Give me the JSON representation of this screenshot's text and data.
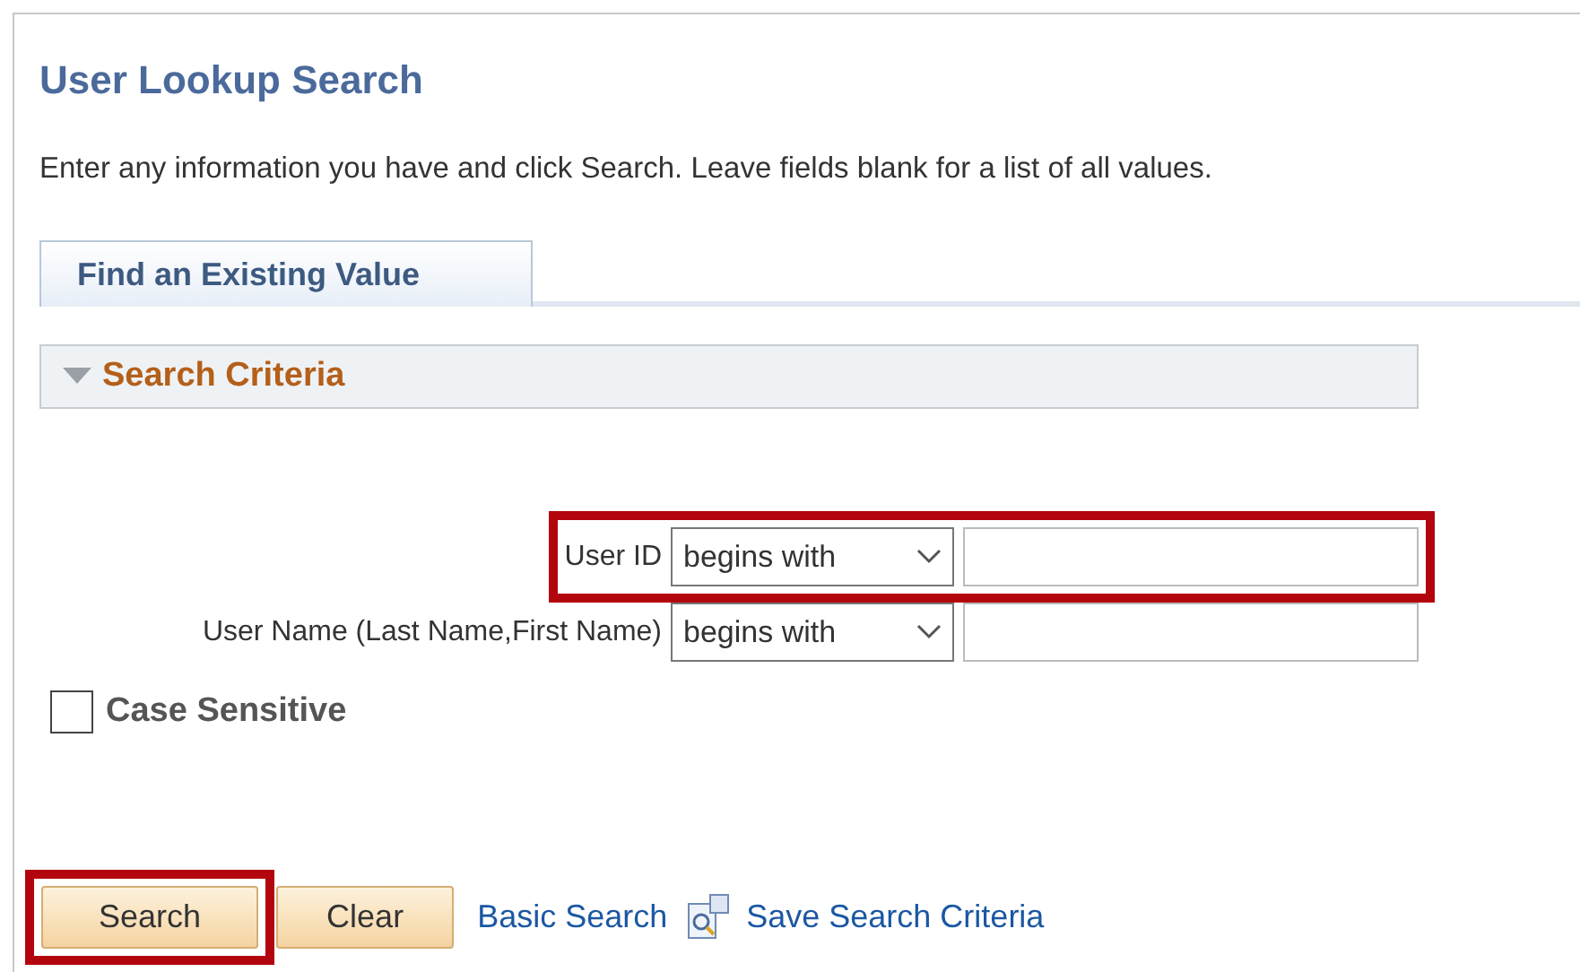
{
  "title": "User Lookup Search",
  "instructions": "Enter any information you have and click Search. Leave fields blank for a list of all values.",
  "tabs": [
    {
      "label": "Find an Existing Value",
      "selected": true
    }
  ],
  "section": {
    "title": "Search Criteria",
    "expanded": true
  },
  "criteria": [
    {
      "label": "User ID",
      "operator": "begins with",
      "highlighted": true
    },
    {
      "label": "User Name (Last Name,First Name)",
      "operator": "begins with",
      "highlighted": false
    }
  ],
  "case_sensitive": {
    "label": "Case Sensitive",
    "checked": false
  },
  "actions": [
    {
      "kind": "button",
      "label": "Search",
      "highlighted": true
    },
    {
      "kind": "button",
      "label": "Clear",
      "highlighted": false
    },
    {
      "kind": "link",
      "label": "Basic Search"
    },
    {
      "kind": "icon"
    },
    {
      "kind": "link",
      "label": "Save Search Criteria"
    }
  ]
}
